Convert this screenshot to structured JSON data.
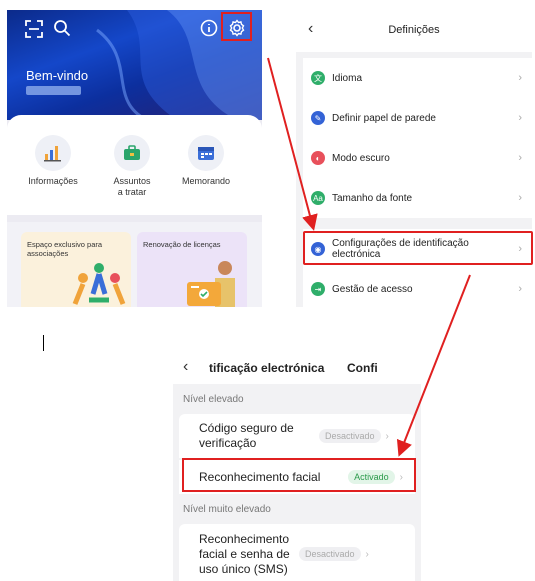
{
  "home": {
    "welcome": "Bem-vindo",
    "quick_actions": [
      {
        "label": "Informações",
        "icon": "chart-bars-icon",
        "color": "#f0a33a"
      },
      {
        "label": "Assuntos a tratar",
        "icon": "briefcase-icon",
        "color": "#2aa56b"
      },
      {
        "label": "Memorando",
        "icon": "calendar-icon",
        "color": "#3a6ed8"
      }
    ],
    "cards": [
      {
        "title": "Espaço exclusivo para associações",
        "bg": "#fbf1dc"
      },
      {
        "title": "Renovação de licenças",
        "bg": "#ece3f8"
      }
    ]
  },
  "settings": {
    "title": "Definições",
    "items": [
      {
        "label": "Idioma",
        "icon": "language-icon",
        "color": "#2fae6a"
      },
      {
        "label": "Definir papel de parede",
        "icon": "wallpaper-icon",
        "color": "#3463d6"
      },
      {
        "label": "Modo escuro",
        "icon": "dark-mode-icon",
        "color": "#e8505b"
      },
      {
        "label": "Tamanho da fonte",
        "icon": "font-size-icon",
        "color": "#2fae6a"
      },
      {
        "label": "Configurações de identificação electrónica",
        "icon": "eid-icon",
        "color": "#3463d6"
      },
      {
        "label": "Gestão de acesso",
        "icon": "access-icon",
        "color": "#2fae6a"
      }
    ]
  },
  "eid": {
    "title": "tificação electrónica",
    "title_suffix": "Confi",
    "section_high": "Nível elevado",
    "section_very_high": "Nível muito elevado",
    "rows": [
      {
        "label": "Código seguro de verificação",
        "status": "Desactivado"
      },
      {
        "label": "Reconhecimento facial",
        "status": "Activado"
      },
      {
        "label": "Reconhecimento facial e senha de uso único (SMS)",
        "status": "Desactivado"
      }
    ]
  },
  "colors": {
    "highlight": "#e02020",
    "active_green": "#2a9a4a"
  }
}
